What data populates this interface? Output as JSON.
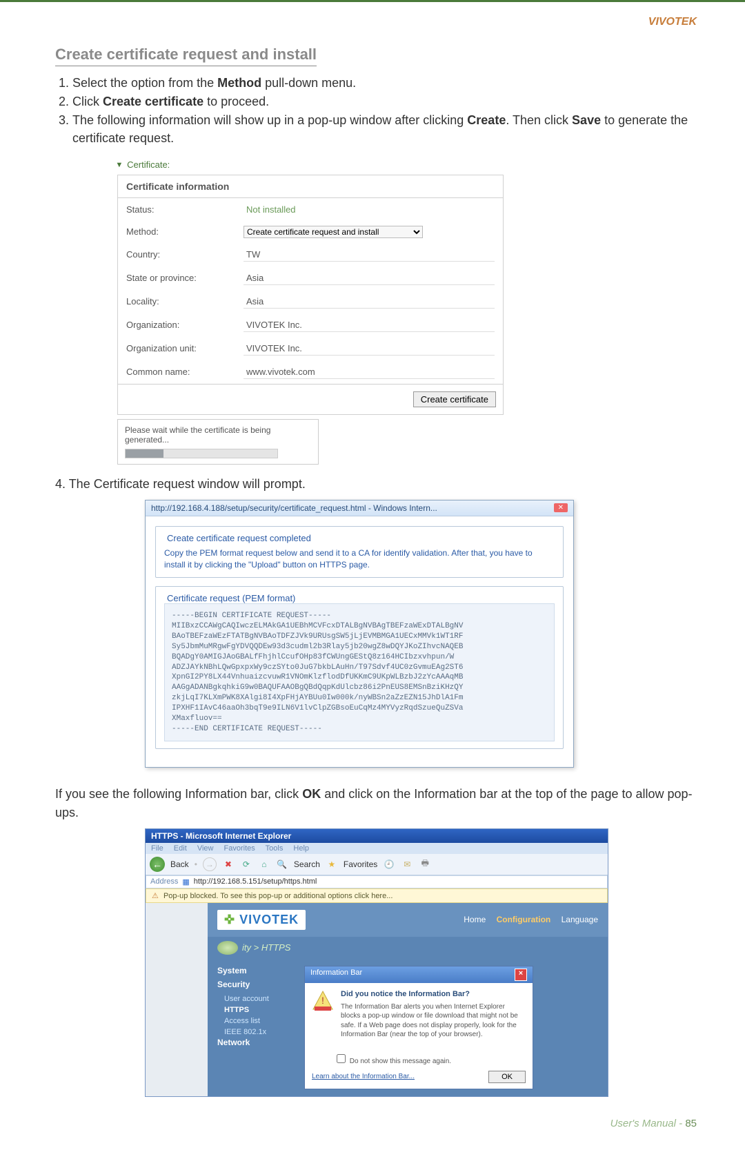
{
  "brand": "VIVOTEK",
  "section_title": "Create certificate request and install",
  "steps": {
    "one_a": "Select the option from the ",
    "one_b": "Method",
    "one_c": " pull-down menu.",
    "two_a": "Click ",
    "two_b": "Create certificate",
    "two_c": " to proceed.",
    "three_a": "The following information will show up in a pop-up window after clicking ",
    "three_b": "Create",
    "three_c": ". Then click ",
    "three_d": "Save",
    "three_e": " to generate the certificate request."
  },
  "cert_panel": {
    "collapse_label": "Certificate:",
    "box_title": "Certificate information",
    "rows": {
      "status_label": "Status:",
      "status_value": "Not installed",
      "method_label": "Method:",
      "method_value": "Create certificate request and install",
      "country_label": "Country:",
      "country_value": "TW",
      "state_label": "State or province:",
      "state_value": "Asia",
      "locality_label": "Locality:",
      "locality_value": "Asia",
      "org_label": "Organization:",
      "org_value": "VIVOTEK Inc.",
      "orgunit_label": "Organization unit:",
      "orgunit_value": "VIVOTEK Inc.",
      "cn_label": "Common name:",
      "cn_value": "www.vivotek.com"
    },
    "create_button": "Create certificate",
    "wait_text": "Please wait while the certificate is being generated..."
  },
  "step4": "4. The Certificate request window will prompt.",
  "popup": {
    "url": "http://192.168.4.188/setup/security/certificate_request.html - Windows Intern...",
    "group1": "Create certificate request completed",
    "group1_desc": "Copy the PEM format request below and send it to a CA for identify validation. After that, you have to install it by clicking the \"Upload\" button on HTTPS page.",
    "group2": "Certificate request (PEM format)",
    "pem": "-----BEGIN CERTIFICATE REQUEST-----\nMIIBxzCCAWgCAQIwczELMAkGA1UEBhMCVFcxDTALBgNVBAgTBEFzaWExDTALBgNV\nBAoTBEFzaWEzFTATBgNVBAoTDFZJVk9URUsgSW5jLjEVMBMGA1UECxMMVk1WT1RF\nSy5JbmMuMRgwFgYDVQQDEw93d3cudml2b3Rlay5jb20wgZ8wDQYJKoZIhvcNAQEB\nBQADgY0AMIGJAoGBALfFhjhlCcufOHp83fCWUngGEStQ8z164HCIbzxvhpun/W\nADZJAYkNBhLQwGpxpxWy9czSYto0JuG7bkbLAuHn/T97Sdvf4UC0zGvmuEAg2ST6\nXpnGI2PY8LX44VnhuaizcvuwR1VNOmKlzflodDfUKKmC9UKpWLBzbJ2zYcAAAqMB\nAAGgADANBgkqhkiG9w0BAQUFAAOBgQBdQqpKdUlcbz86i2PnEUS8EMSnBziKHzQY\nzkjLqI7KLXmPWK8XAlgi8I4XpFHjAYBUu0Iw000k/nyWBSn2aZzEZN15JhDlA1Fm\nIPXHF1IAvC46aaOh3bqT9e9ILN6V1lvClpZGBsoEuCqMz4MYVyzRqdSzueQuZSVa\nXMaxfluov==\n-----END CERTIFICATE REQUEST-----"
  },
  "info_para_a": "If you see the following Information bar, click ",
  "info_para_b": "OK",
  "info_para_c": " and click on the Information bar at the top of the page to allow pop-ups.",
  "ie": {
    "title": "HTTPS - Microsoft Internet Explorer",
    "menu": {
      "file": "File",
      "edit": "Edit",
      "view": "View",
      "fav": "Favorites",
      "tools": "Tools",
      "help": "Help"
    },
    "back": "Back",
    "search": "Search",
    "favorites": "Favorites",
    "address_label": "Address",
    "address": "http://192.168.5.151/setup/https.html",
    "infobar": "Pop-up blocked. To see this pop-up or additional options click here...",
    "logo": "VIVOTEK",
    "nav_home": "Home",
    "nav_cfg": "Configuration",
    "nav_lang": "Language",
    "breadcrumb": "ity > HTTPS",
    "side": {
      "system": "System",
      "security": "Security",
      "user": "User account",
      "https": "HTTPS",
      "access": "Access list",
      "ieee": "IEEE 802.1x",
      "network": "Network"
    },
    "dlg": {
      "title": "Information Bar",
      "q": "Did you notice the Information Bar?",
      "p": "The Information Bar alerts you when Internet Explorer blocks a pop-up window or file download that might not be safe. If a Web page does not display properly, look for the Information Bar (near the top of your browser).",
      "checkbox": "Do not show this message again.",
      "learn": "Learn about the Information Bar...",
      "ok": "OK"
    }
  },
  "footer_label": "User's Manual - ",
  "footer_page": "85"
}
